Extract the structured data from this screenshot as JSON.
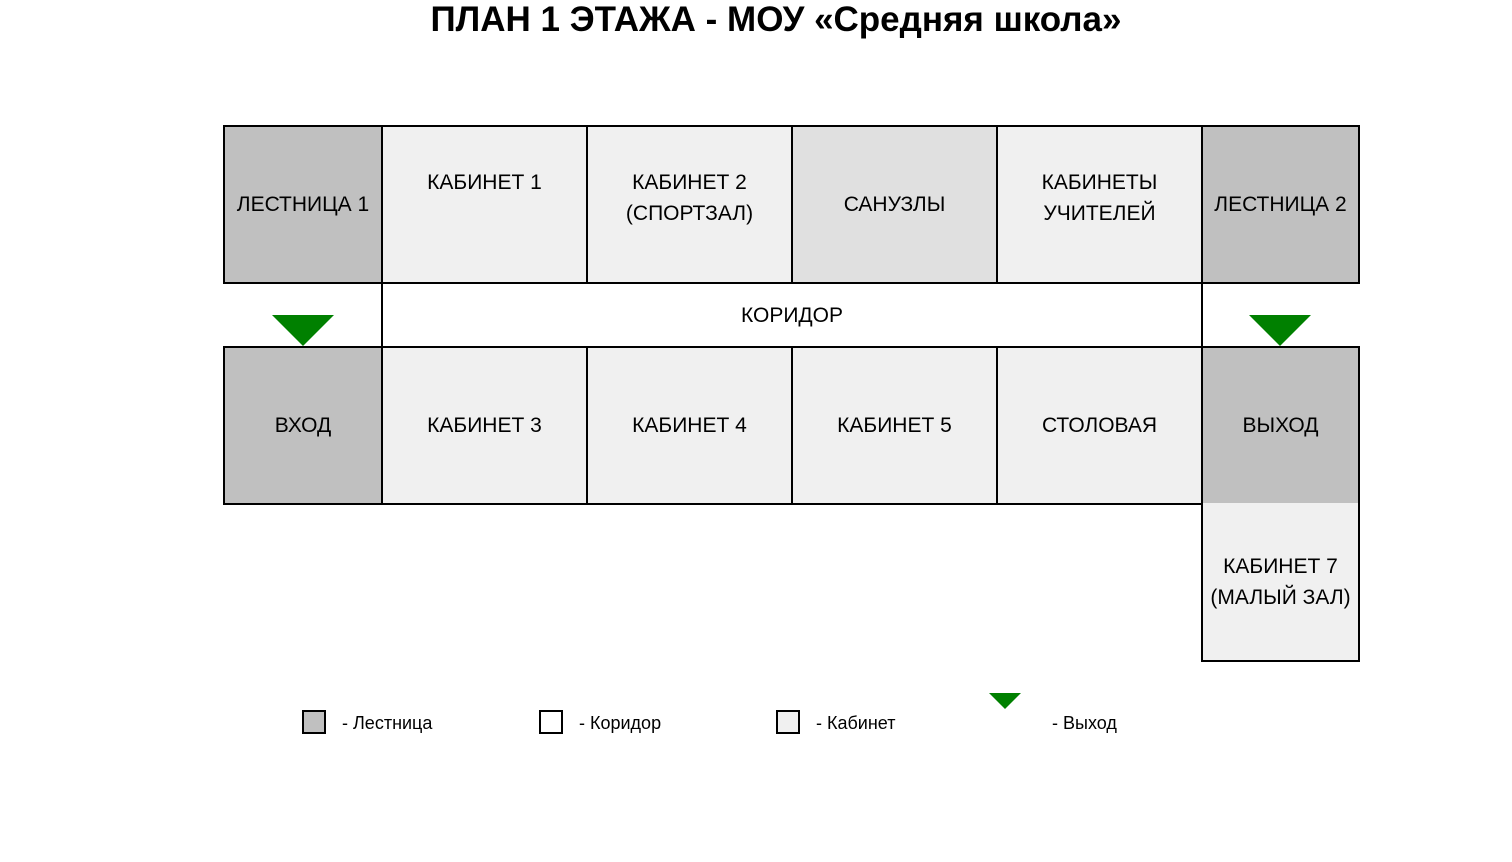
{
  "title": "ПЛАН 1 ЭТАЖА - МОУ «Средняя школа»",
  "rooms": {
    "stair1": "ЛЕСТНИЦА 1",
    "cab1": "КАБИНЕТ 1",
    "cab2": "КАБИНЕТ 2\n(СПОРТЗАЛ)",
    "wc": "САНУЗЛЫ",
    "teachers": "КАБИНЕТЫ\nУЧИТЕЛЕЙ",
    "stair2": "ЛЕСТНИЦА 2",
    "corridor": "КОРИДОР",
    "entrance": "ВХОД",
    "cab3": "КАБИНЕТ 3",
    "cab4": "КАБИНЕТ 4",
    "cab5": "КАБИНЕТ 5",
    "canteen": "СТОЛОВАЯ",
    "exit": "ВЫХОД",
    "cab7": "КАБИНЕТ 7\n(МАЛЫЙ ЗАЛ)"
  },
  "legend": {
    "stair": "- Лестница",
    "corridor": "- Коридор",
    "room": "- Кабинет",
    "exit": "- Выход"
  },
  "colors": {
    "stair": "#c0c0c0",
    "room": "#f0f0f0",
    "sanitary": "#e0e0e0",
    "corridor": "#ffffff",
    "exit_marker": "#008000"
  }
}
